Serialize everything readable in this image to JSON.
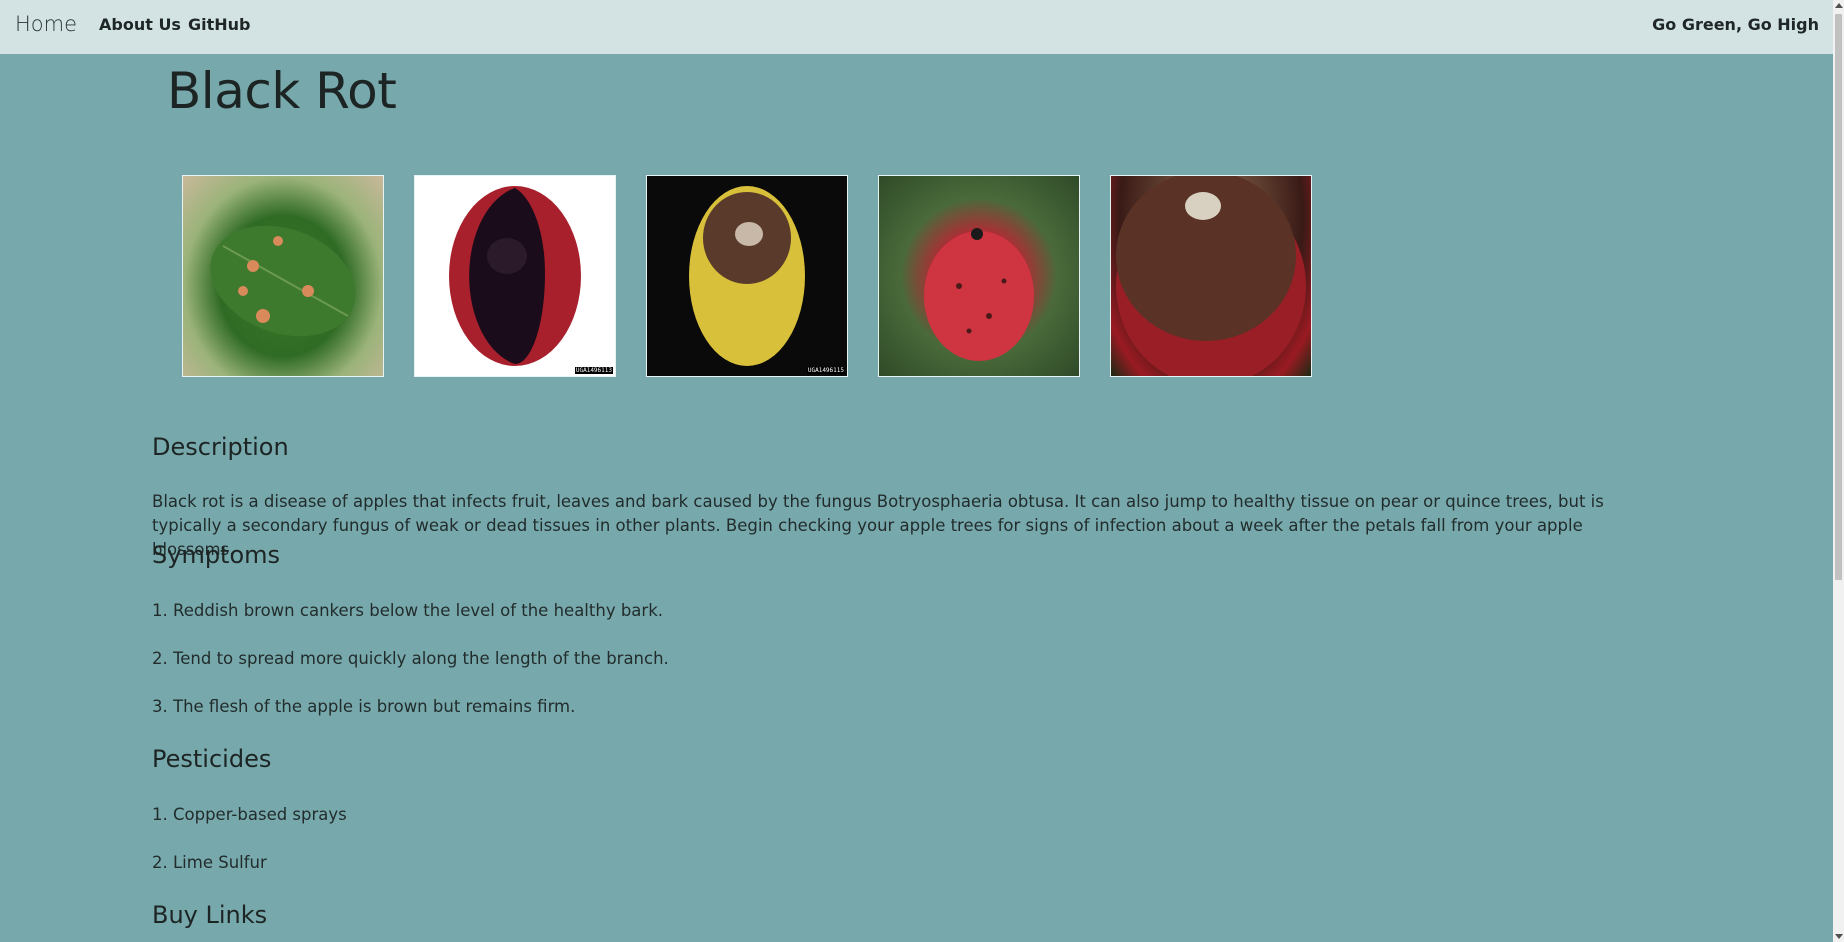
{
  "navbar": {
    "brand": "Home",
    "links": [
      "About Us",
      "GitHub"
    ],
    "tagline": "Go Green, Go High"
  },
  "page": {
    "title": "Black Rot"
  },
  "gallery": {
    "tags": [
      "",
      "UGA1496113",
      "UGA1496115",
      "",
      ""
    ]
  },
  "description": {
    "heading": "Description",
    "text": "Black rot is a disease of apples that infects fruit, leaves and bark caused by the fungus Botryosphaeria obtusa. It can also jump to healthy tissue on pear or quince trees, but is typically a secondary fungus of weak or dead tissues in other plants. Begin checking your apple trees for signs of infection about a week after the petals fall from your apple blossoms."
  },
  "symptoms": {
    "heading": "Symptoms",
    "items": [
      "1. Reddish brown cankers below the level of the healthy bark.",
      "2. Tend to spread more quickly along the length of the branch.",
      "3. The flesh of the apple is brown but remains firm."
    ]
  },
  "pesticides": {
    "heading": "Pesticides",
    "items": [
      "1. Copper-based sprays",
      "2. Lime Sulfur"
    ]
  },
  "buy_links": {
    "heading": "Buy Links"
  },
  "colors": {
    "page_bg": "#77a9ac",
    "navbar_bg": "#d3e3e4"
  }
}
